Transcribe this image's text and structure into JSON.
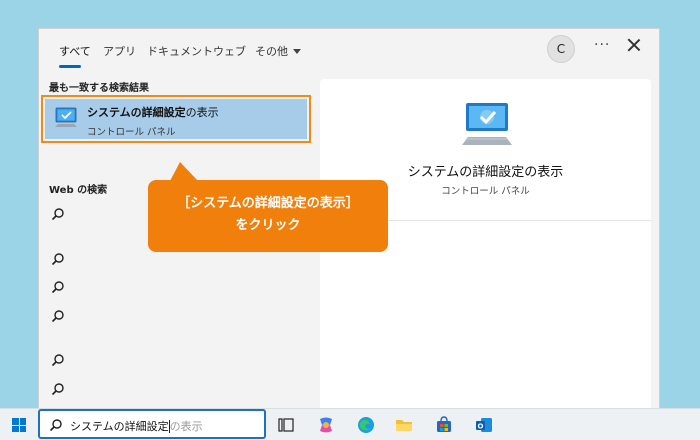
{
  "tabs": [
    {
      "label": "すべて",
      "active": true
    },
    {
      "label": "アプリ"
    },
    {
      "label": "ドキュメント"
    },
    {
      "label": "ウェブ"
    },
    {
      "label": "その他"
    }
  ],
  "header": {
    "avatar_initial": "C",
    "more_label": "···"
  },
  "left": {
    "best_match_heading": "最も一致する検索結果",
    "best_match": {
      "title_bold": "システムの詳細設定",
      "title_rest": "の表示",
      "subtitle": "コントロール パネル",
      "icon": "monitor-check-icon"
    },
    "web_heading": "Web の検索"
  },
  "preview": {
    "title": "システムの詳細設定の表示",
    "subtitle": "コントロール パネル",
    "icon": "monitor-check-icon"
  },
  "callout": {
    "line1": "［システムの詳細設定の表示］",
    "line2": "をクリック",
    "color": "#f07f0c"
  },
  "taskbar": {
    "search_typed": "システムの詳細設定",
    "search_ghost": "の表示",
    "apps": [
      "task-view-icon",
      "copilot-icon",
      "edge-icon",
      "file-explorer-icon",
      "store-icon",
      "outlook-icon"
    ]
  },
  "colors": {
    "accent": "#0067c0",
    "highlight": "#a7cce9",
    "callout": "#f07f0c"
  }
}
